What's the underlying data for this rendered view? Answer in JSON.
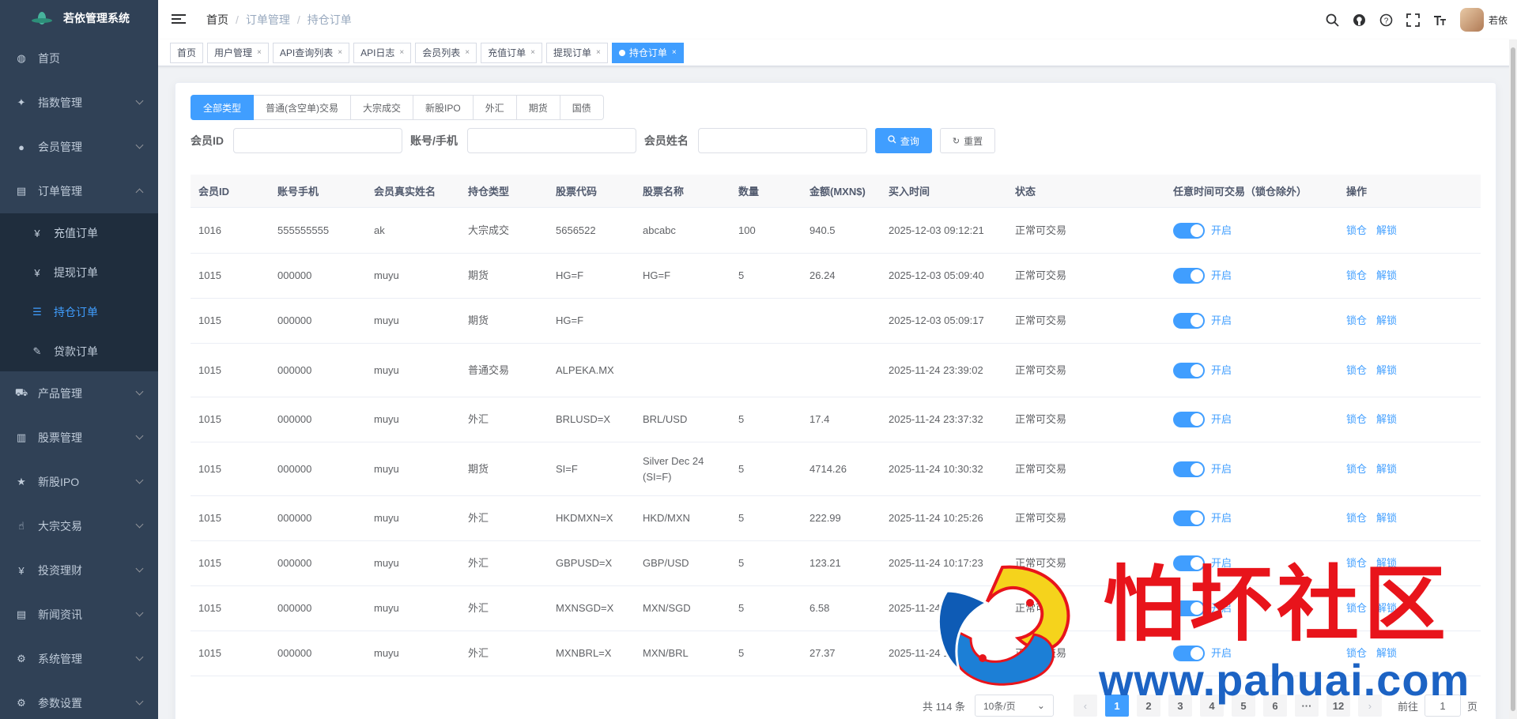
{
  "app": {
    "title": "若依管理系统"
  },
  "sidebar": {
    "items": [
      {
        "label": "首页",
        "icon": "dashboard-icon",
        "glyph": "◍"
      },
      {
        "label": "指数管理",
        "icon": "index-icon",
        "glyph": "✦"
      },
      {
        "label": "会员管理",
        "icon": "user-icon",
        "glyph": "●"
      },
      {
        "label": "订单管理",
        "icon": "order-icon",
        "glyph": "▤"
      }
    ],
    "submenu": [
      {
        "label": "充值订单",
        "icon": "yen-icon",
        "glyph": "¥"
      },
      {
        "label": "提现订单",
        "icon": "yen-icon",
        "glyph": "¥"
      },
      {
        "label": "持仓订单",
        "icon": "list-icon",
        "glyph": "☰"
      },
      {
        "label": "贷款订单",
        "icon": "edit-icon",
        "glyph": "✎"
      }
    ],
    "items2": [
      {
        "label": "产品管理",
        "icon": "cart-icon",
        "glyph": "⛟"
      },
      {
        "label": "股票管理",
        "icon": "bar-chart-icon",
        "glyph": "▥"
      },
      {
        "label": "新股IPO",
        "icon": "star-icon",
        "glyph": "★"
      },
      {
        "label": "大宗交易",
        "icon": "hand-icon",
        "glyph": "☝"
      },
      {
        "label": "投资理财",
        "icon": "yen-icon",
        "glyph": "¥"
      },
      {
        "label": "新闻资讯",
        "icon": "news-icon",
        "glyph": "▤"
      },
      {
        "label": "系统管理",
        "icon": "settings-icon",
        "glyph": "⚙"
      },
      {
        "label": "参数设置",
        "icon": "params-icon",
        "glyph": "⚙"
      }
    ]
  },
  "navbar": {
    "breadcrumb": [
      "首页",
      "订单管理",
      "持仓订单"
    ],
    "username": "若依"
  },
  "tags": [
    {
      "label": "首页",
      "closable": false
    },
    {
      "label": "用户管理",
      "closable": true
    },
    {
      "label": "API查询列表",
      "closable": true
    },
    {
      "label": "API日志",
      "closable": true
    },
    {
      "label": "会员列表",
      "closable": true
    },
    {
      "label": "充值订单",
      "closable": true
    },
    {
      "label": "提现订单",
      "closable": true
    },
    {
      "label": "持仓订单",
      "closable": true,
      "active": true
    }
  ],
  "filters": {
    "types": [
      "全部类型",
      "普通(含空单)交易",
      "大宗成交",
      "新股IPO",
      "外汇",
      "期货",
      "国债"
    ],
    "active_type": "全部类型",
    "member_id_label": "会员ID",
    "account_label": "账号/手机",
    "name_label": "会员姓名",
    "search_btn": "查询",
    "reset_btn": "重置"
  },
  "table": {
    "headers": [
      "会员ID",
      "账号手机",
      "会员真实姓名",
      "持仓类型",
      "股票代码",
      "股票名称",
      "数量",
      "金额(MXN$)",
      "买入时间",
      "状态",
      "任意时间可交易（锁仓除外）",
      "操作"
    ],
    "switch_label": "开启",
    "action_lock": "锁仓",
    "action_unlock": "解锁",
    "rows": [
      [
        "1016",
        "555555555",
        "ak",
        "大宗成交",
        "5656522",
        "abcabc",
        "100",
        "940.5",
        "2025-12-03 09:12:21",
        "正常可交易"
      ],
      [
        "1015",
        "000000",
        "muyu",
        "期货",
        "HG=F",
        "HG=F",
        "5",
        "26.24",
        "2025-12-03 05:09:40",
        "正常可交易"
      ],
      [
        "1015",
        "000000",
        "muyu",
        "期货",
        "HG=F",
        "",
        "",
        "",
        "2025-12-03 05:09:17",
        "正常可交易"
      ],
      [
        "1015",
        "000000",
        "muyu",
        "普通交易",
        "ALPEKA.MX",
        "",
        "",
        "",
        "2025-11-24 23:39:02",
        "正常可交易"
      ],
      [
        "1015",
        "000000",
        "muyu",
        "外汇",
        "BRLUSD=X",
        "BRL/USD",
        "5",
        "17.4",
        "2025-11-24 23:37:32",
        "正常可交易"
      ],
      [
        "1015",
        "000000",
        "muyu",
        "期货",
        "SI=F",
        "Silver Dec 24 (SI=F)",
        "5",
        "4714.26",
        "2025-11-24 10:30:32",
        "正常可交易"
      ],
      [
        "1015",
        "000000",
        "muyu",
        "外汇",
        "HKDMXN=X",
        "HKD/MXN",
        "5",
        "222.99",
        "2025-11-24 10:25:26",
        "正常可交易"
      ],
      [
        "1015",
        "000000",
        "muyu",
        "外汇",
        "GBPUSD=X",
        "GBP/USD",
        "5",
        "123.21",
        "2025-11-24 10:17:23",
        "正常可交易"
      ],
      [
        "1015",
        "000000",
        "muyu",
        "外汇",
        "MXNSGD=X",
        "MXN/SGD",
        "5",
        "6.58",
        "2025-11-24 10",
        "正常可交易"
      ],
      [
        "1015",
        "000000",
        "muyu",
        "外汇",
        "MXNBRL=X",
        "MXN/BRL",
        "5",
        "27.37",
        "2025-11-24 10",
        "正常可交易"
      ]
    ]
  },
  "pagination": {
    "total": "共 114 条",
    "page_size": "10条/页",
    "pages": [
      "1",
      "2",
      "3",
      "4",
      "5",
      "6",
      "···",
      "12"
    ],
    "current": "1",
    "goto_prefix": "前往",
    "goto_value": "1",
    "goto_suffix": "页"
  },
  "watermark": {
    "title": "怕坏社区",
    "url": "www.pahuai.com"
  }
}
